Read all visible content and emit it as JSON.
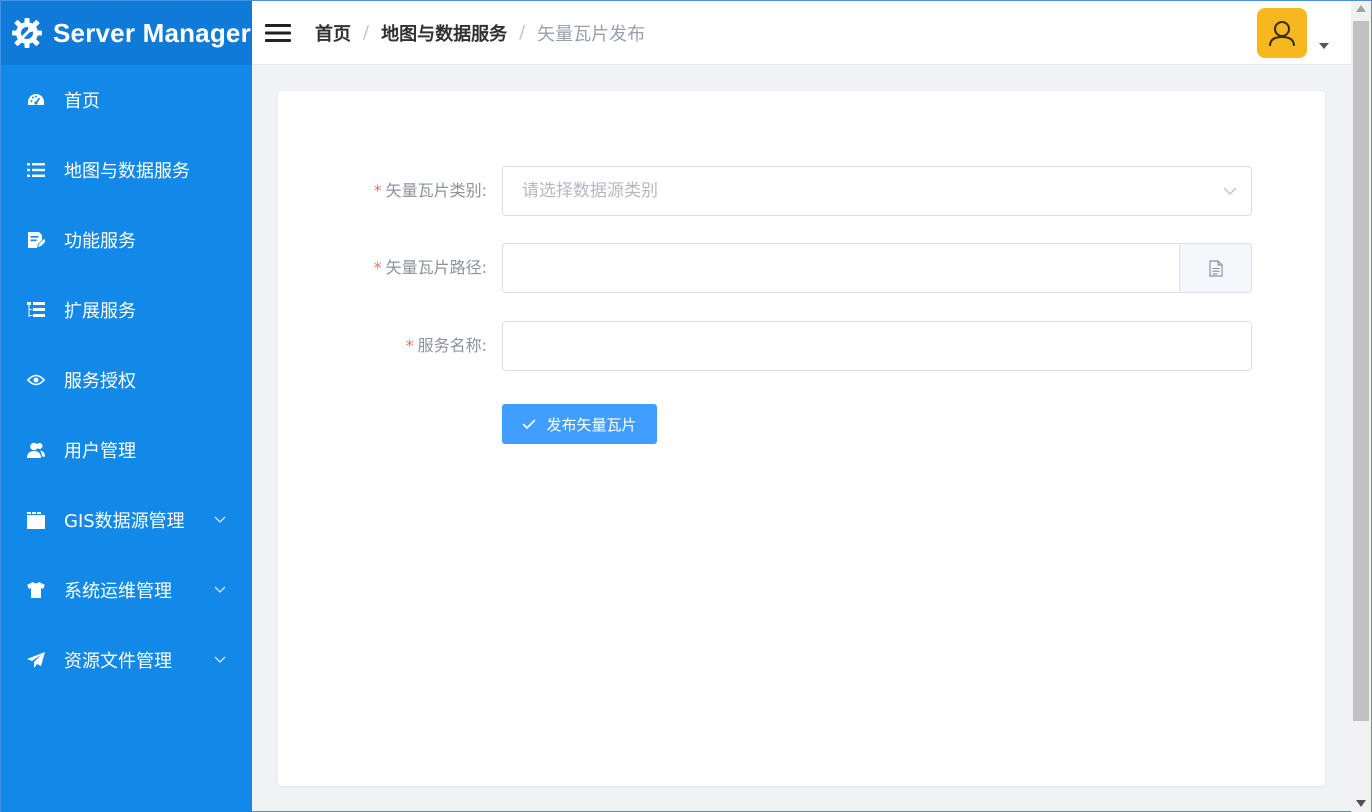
{
  "app": {
    "title": "Server Manager"
  },
  "colors": {
    "sidebar": "#1289e8",
    "brand_bar": "#0f7ad8",
    "primary_button": "#409eff",
    "avatar_bg": "#f6b71f",
    "required": "#f56c6c"
  },
  "sidebar": {
    "items": [
      {
        "label": "首页",
        "icon": "dashboard-icon"
      },
      {
        "label": "地图与数据服务",
        "icon": "list-icon"
      },
      {
        "label": "功能服务",
        "icon": "document-edit-icon"
      },
      {
        "label": "扩展服务",
        "icon": "tree-list-icon"
      },
      {
        "label": "服务授权",
        "icon": "eye-icon"
      },
      {
        "label": "用户管理",
        "icon": "users-icon"
      },
      {
        "label": "GIS数据源管理",
        "icon": "folder-icon",
        "expandable": true
      },
      {
        "label": "系统运维管理",
        "icon": "shirt-icon",
        "expandable": true
      },
      {
        "label": "资源文件管理",
        "icon": "paper-plane-icon",
        "expandable": true
      }
    ]
  },
  "header": {
    "breadcrumb": [
      "首页",
      "地图与数据服务",
      "矢量瓦片发布"
    ],
    "separator": "/"
  },
  "form": {
    "required_mark": "*",
    "tile_type": {
      "label": "矢量瓦片类别:",
      "placeholder": "请选择数据源类别",
      "value": ""
    },
    "tile_path": {
      "label": "矢量瓦片路径:",
      "value": ""
    },
    "service_name": {
      "label": "服务名称:",
      "value": ""
    },
    "submit_label": "发布矢量瓦片"
  }
}
